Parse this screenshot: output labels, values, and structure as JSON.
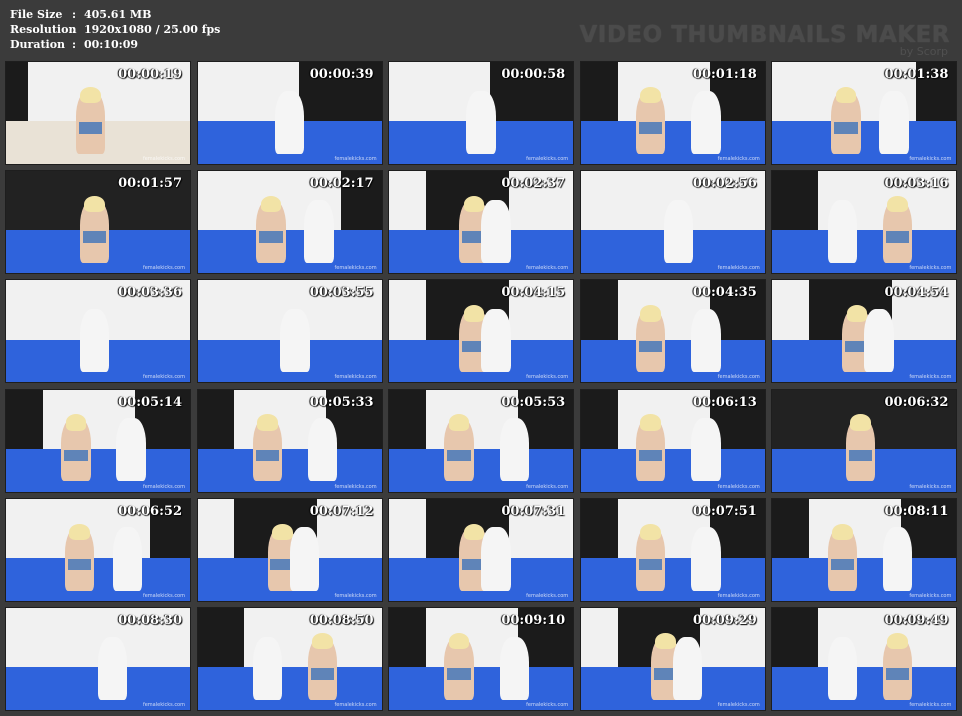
{
  "info": {
    "rows": [
      {
        "label": "File Size",
        "sep": ":",
        "value": "405.61 MB"
      },
      {
        "label": "Resolution",
        "sep": ":",
        "value": "1920x1080 / 25.00 fps"
      },
      {
        "label": "Duration",
        "sep": ":",
        "value": "00:10:09"
      }
    ]
  },
  "brand": {
    "title": "VIDEO THUMBNAILS MAKER",
    "subtitle": "by Scorp"
  },
  "watermark": "femalekicks.com",
  "thumbnails": [
    {
      "time": "00:00:19",
      "scene": "legs-closeup"
    },
    {
      "time": "00:00:39",
      "scene": "man-portrait"
    },
    {
      "time": "00:00:58",
      "scene": "man-portrait"
    },
    {
      "time": "00:01:18",
      "scene": "pair-standing"
    },
    {
      "time": "00:01:38",
      "scene": "pair-kick"
    },
    {
      "time": "00:01:57",
      "scene": "woman-closeup"
    },
    {
      "time": "00:02:17",
      "scene": "pair-kick"
    },
    {
      "time": "00:02:37",
      "scene": "pair-hold"
    },
    {
      "time": "00:02:56",
      "scene": "man-floor"
    },
    {
      "time": "00:03:16",
      "scene": "pair-floor"
    },
    {
      "time": "00:03:36",
      "scene": "man-bent"
    },
    {
      "time": "00:03:55",
      "scene": "man-floor"
    },
    {
      "time": "00:04:15",
      "scene": "pair-hold"
    },
    {
      "time": "00:04:35",
      "scene": "pair-standing"
    },
    {
      "time": "00:04:54",
      "scene": "pair-hold"
    },
    {
      "time": "00:05:14",
      "scene": "pair-standing"
    },
    {
      "time": "00:05:33",
      "scene": "pair-standing"
    },
    {
      "time": "00:05:53",
      "scene": "pair-standing"
    },
    {
      "time": "00:06:13",
      "scene": "pair-standing"
    },
    {
      "time": "00:06:32",
      "scene": "woman-closeup"
    },
    {
      "time": "00:06:52",
      "scene": "pair-kick"
    },
    {
      "time": "00:07:12",
      "scene": "pair-hold"
    },
    {
      "time": "00:07:31",
      "scene": "pair-hold"
    },
    {
      "time": "00:07:51",
      "scene": "pair-standing"
    },
    {
      "time": "00:08:11",
      "scene": "pair-standing"
    },
    {
      "time": "00:08:30",
      "scene": "feet-closeup"
    },
    {
      "time": "00:08:50",
      "scene": "pair-floor"
    },
    {
      "time": "00:09:10",
      "scene": "pair-standing"
    },
    {
      "time": "00:09:29",
      "scene": "pair-hold"
    },
    {
      "time": "00:09:49",
      "scene": "pair-floor"
    }
  ],
  "colors": {
    "background": "#3b3b3b",
    "mat": "#2f63dc",
    "wall": "#f1f1f1",
    "panel": "#1b1b1b"
  }
}
